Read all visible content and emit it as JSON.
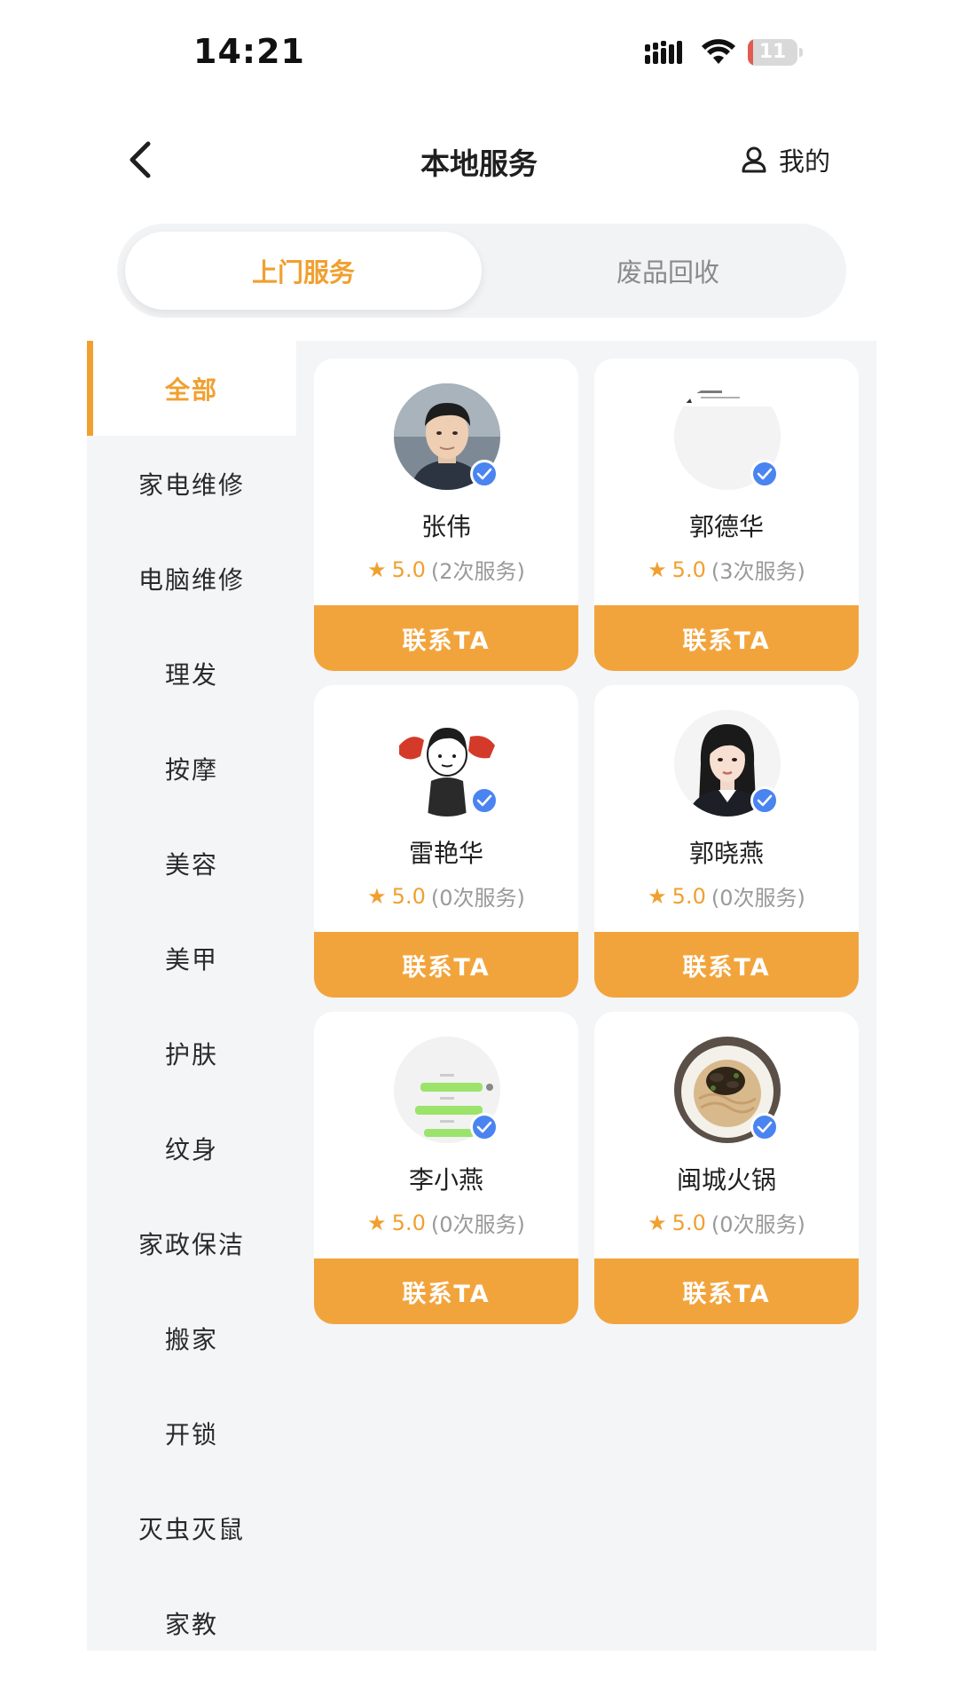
{
  "status_bar": {
    "time": "14:21",
    "battery_level": "11",
    "battery_color": "#e25b50"
  },
  "nav": {
    "title": "本地服务",
    "mine_label": "我的"
  },
  "tabs": [
    {
      "label": "上门服务",
      "active": true
    },
    {
      "label": "废品回收",
      "active": false
    }
  ],
  "categories": [
    {
      "label": "全部",
      "active": true
    },
    {
      "label": "家电维修"
    },
    {
      "label": "电脑维修"
    },
    {
      "label": "理发"
    },
    {
      "label": "按摩"
    },
    {
      "label": "美容"
    },
    {
      "label": "美甲"
    },
    {
      "label": "护肤"
    },
    {
      "label": "纹身"
    },
    {
      "label": "家政保洁"
    },
    {
      "label": "搬家"
    },
    {
      "label": "开锁"
    },
    {
      "label": "灭虫灭鼠"
    },
    {
      "label": "家教"
    }
  ],
  "providers": [
    {
      "name": "张伟",
      "rating": "5.0",
      "services": "(2次服务)",
      "contact_label": "联系TA",
      "avatar": "portrait-man"
    },
    {
      "name": "郭德华",
      "rating": "5.0",
      "services": "(3次服务)",
      "contact_label": "联系TA",
      "avatar": "blank-screenshot"
    },
    {
      "name": "雷艳华",
      "rating": "5.0",
      "services": "(0次服务)",
      "contact_label": "联系TA",
      "avatar": "cartoon-professional"
    },
    {
      "name": "郭晓燕",
      "rating": "5.0",
      "services": "(0次服务)",
      "contact_label": "联系TA",
      "avatar": "portrait-woman"
    },
    {
      "name": "李小燕",
      "rating": "5.0",
      "services": "(0次服务)",
      "contact_label": "联系TA",
      "avatar": "chat-screenshot"
    },
    {
      "name": "闽城火锅",
      "rating": "5.0",
      "services": "(0次服务)",
      "contact_label": "联系TA",
      "avatar": "noodle-dish"
    }
  ],
  "colors": {
    "accent": "#f0a030",
    "button": "#f2a43c",
    "verify": "#4a84f0"
  },
  "icons": {
    "back": "chevron-left-icon",
    "mine": "user-icon",
    "star": "star-icon",
    "verified": "checkmark-icon"
  }
}
